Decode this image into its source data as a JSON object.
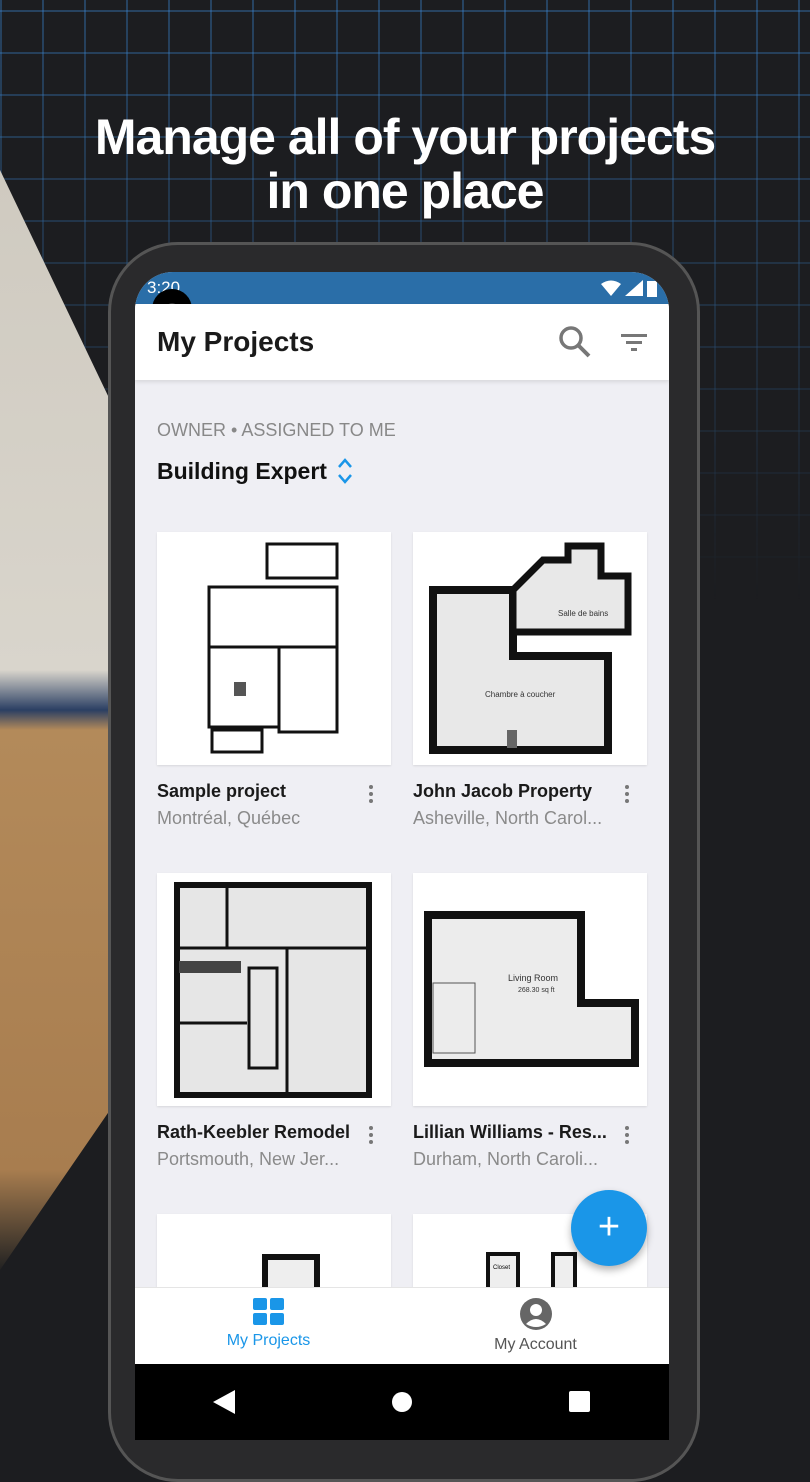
{
  "headline": {
    "line1": "Manage all of your projects",
    "line2": "in one place"
  },
  "status_bar": {
    "time": "3:20",
    "icons": [
      "wifi-icon",
      "signal-icon",
      "battery-icon"
    ],
    "color": "#2a6ea8"
  },
  "appbar": {
    "title": "My Projects",
    "actions": [
      "search-icon",
      "filter-icon"
    ]
  },
  "filters": {
    "owner": "OWNER",
    "separator": "•",
    "assigned": "ASSIGNED TO ME"
  },
  "workspace": {
    "name": "Building Expert",
    "icon": "chevron-up-down-icon"
  },
  "projects": [
    {
      "title": "Sample project",
      "location": "Montréal, Québec"
    },
    {
      "title": "John Jacob Property",
      "location": "Asheville, North Carol..."
    },
    {
      "title": "Rath-Keebler Remodel",
      "location": "Portsmouth, New Jer..."
    },
    {
      "title": "Lillian Williams - Res...",
      "location": "Durham, North Caroli..."
    },
    {
      "title": "",
      "location": ""
    },
    {
      "title": "",
      "location": ""
    }
  ],
  "plan_labels": {
    "p2a": "Salle de bains",
    "p2b": "Chambre à coucher",
    "p4": "Living Room",
    "p4b": "268.30 sq ft",
    "p6": "Closet"
  },
  "fab": {
    "label": "+",
    "color": "#1a96e8"
  },
  "bottom_nav": [
    {
      "label": "My Projects",
      "icon": "grid-icon",
      "active": true
    },
    {
      "label": "My Account",
      "icon": "account-circle-icon",
      "active": false
    }
  ],
  "accent": "#1a96e8"
}
